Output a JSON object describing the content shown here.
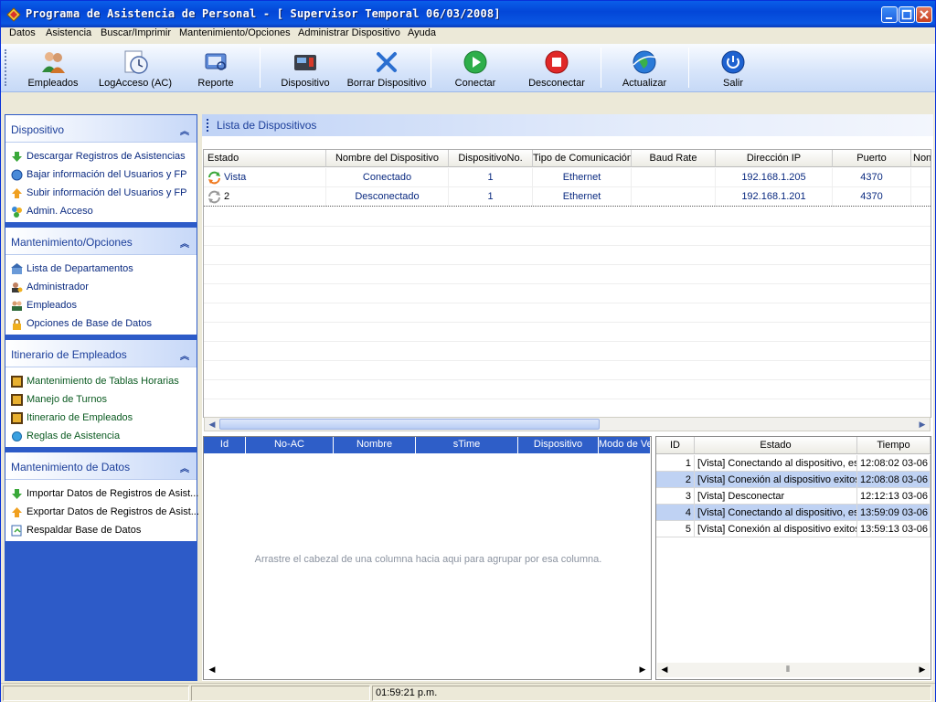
{
  "window": {
    "title": "Programa de Asistencia de Personal - [ Supervisor Temporal 06/03/2008]"
  },
  "menu": [
    "Datos",
    "Asistencia",
    "Buscar/Imprimir",
    "Mantenimiento/Opciones",
    "Administrar Dispositivo",
    "Ayuda"
  ],
  "toolbar": {
    "empleados": "Empleados",
    "logacceso": "LogAcceso (AC)",
    "reporte": "Reporte",
    "dispositivo": "Dispositivo",
    "borrar": "Borrar Dispositivo",
    "conectar": "Conectar",
    "desconectar": "Desconectar",
    "actualizar": "Actualizar",
    "salir": "Salir"
  },
  "sidebar": {
    "g1": {
      "title": "Dispositivo",
      "items": [
        "Descargar Registros de Asistencias",
        "Bajar información del Usuarios y FP",
        "Subir información del Usuarios y FP",
        "Admin. Acceso"
      ]
    },
    "g2": {
      "title": "Mantenimiento/Opciones",
      "items": [
        "Lista de Departamentos",
        "Administrador",
        "Empleados",
        "Opciones de Base de Datos"
      ]
    },
    "g3": {
      "title": "Itinerario de Empleados",
      "items": [
        "Mantenimiento de Tablas Horarias",
        "Manejo de Turnos",
        "Itinerario de Empleados",
        "Reglas de Asistencia"
      ]
    },
    "g4": {
      "title": "Mantenimiento de Datos",
      "items": [
        "Importar Datos de Registros de Asist...",
        "Exportar Datos de Registros de Asist...",
        "Respaldar Base de Datos"
      ]
    }
  },
  "devices": {
    "title": "Lista de Dispositivos",
    "columns": [
      "Estado",
      "Nombre del Dispositivo",
      "DispositivoNo.",
      "Tipo de Comunicación",
      "Baud Rate",
      "Dirección IP",
      "Puerto",
      "Non"
    ],
    "rows": [
      {
        "estado": "Vista",
        "nombre": "Conectado",
        "no": "1",
        "tipo": "Ethernet",
        "baud": "",
        "ip": "192.168.1.205",
        "puerto": "4370"
      },
      {
        "estado": "2",
        "nombre": "Desconectado",
        "no": "1",
        "tipo": "Ethernet",
        "baud": "",
        "ip": "192.168.1.201",
        "puerto": "4370"
      }
    ]
  },
  "records": {
    "columns": [
      "Id",
      "No-AC",
      "Nombre",
      "sTime",
      "Dispositivo",
      "Modo de Ve"
    ],
    "hint": "Arrastre el cabezal de una columna hacia aqui para agrupar por esa columna."
  },
  "log": {
    "columns": [
      "ID",
      "Estado",
      "Tiempo"
    ],
    "rows": [
      {
        "id": "1",
        "estado": "[Vista] Conectando al dispositivo, esp",
        "tiempo": "12:08:02 03-06"
      },
      {
        "id": "2",
        "estado": "[Vista] Conexión al dispositivo exitosa",
        "tiempo": "12:08:08 03-06"
      },
      {
        "id": "3",
        "estado": "[Vista] Desconectar",
        "tiempo": "12:12:13 03-06"
      },
      {
        "id": "4",
        "estado": "[Vista] Conectando al dispositivo, esp",
        "tiempo": "13:59:09 03-06"
      },
      {
        "id": "5",
        "estado": "[Vista] Conexión al dispositivo exitosa",
        "tiempo": "13:59:13 03-06"
      }
    ]
  },
  "status": {
    "time": "01:59:21 p.m."
  }
}
